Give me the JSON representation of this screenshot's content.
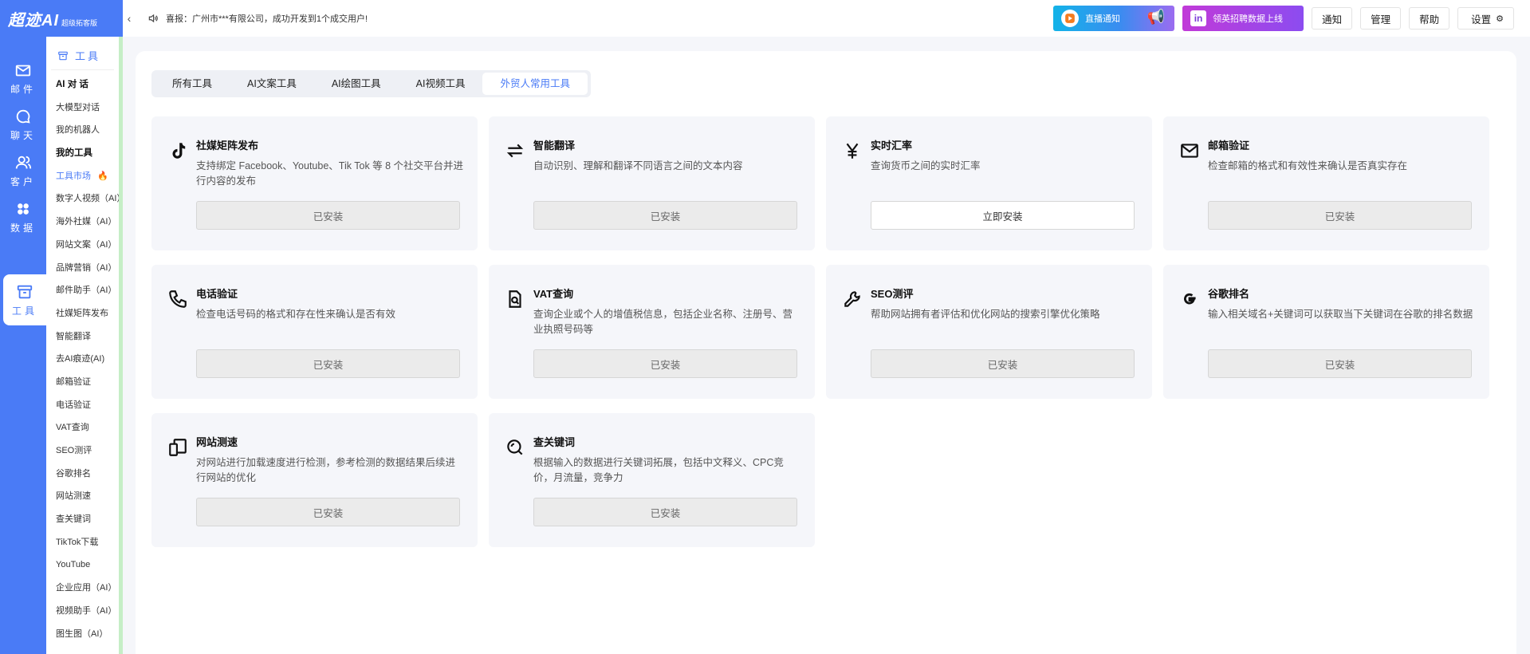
{
  "logo": {
    "main": "超迹AI",
    "sub": "超级拓客版"
  },
  "rail": [
    {
      "label": "邮件",
      "icon": "mail-icon"
    },
    {
      "label": "聊天",
      "icon": "chat-icon"
    },
    {
      "label": "客户",
      "icon": "customers-icon"
    },
    {
      "label": "数据",
      "icon": "data-icon"
    },
    {
      "label": "工具",
      "icon": "toolbox-icon",
      "active": true
    }
  ],
  "submenu": {
    "title": "工具",
    "items": [
      {
        "label": "AI 对 话",
        "group": true
      },
      {
        "label": "大模型对话"
      },
      {
        "label": "我的机器人"
      },
      {
        "label": "我的工具",
        "group": true
      },
      {
        "label": "工具市场",
        "active": true,
        "hot": true
      },
      {
        "label": "数字人视频（AI）"
      },
      {
        "label": "海外社媒（AI）"
      },
      {
        "label": "网站文案（AI）"
      },
      {
        "label": "品牌营销（AI）"
      },
      {
        "label": "邮件助手（AI）"
      },
      {
        "label": "社媒矩阵发布"
      },
      {
        "label": "智能翻译"
      },
      {
        "label": "去AI痕迹(AI)"
      },
      {
        "label": "邮箱验证"
      },
      {
        "label": "电话验证"
      },
      {
        "label": "VAT查询"
      },
      {
        "label": "SEO测评"
      },
      {
        "label": "谷歌排名"
      },
      {
        "label": "网站测速"
      },
      {
        "label": "查关键词"
      },
      {
        "label": "TikTok下载"
      },
      {
        "label": "YouTube"
      },
      {
        "label": "企业应用（AI）"
      },
      {
        "label": "视频助手（AI）"
      },
      {
        "label": "图生图（AI）"
      }
    ]
  },
  "topbar": {
    "collapse": "‹",
    "notice": "喜报：广州市***有限公司，成功开发到1个成交用户!",
    "banner_live": "直播通知",
    "banner_hire": "领英招聘数据上线",
    "notify": "通知",
    "manage": "管理",
    "help": "帮助",
    "settings": "设置"
  },
  "tabs": [
    {
      "label": "所有工具"
    },
    {
      "label": "AI文案工具"
    },
    {
      "label": "AI绘图工具"
    },
    {
      "label": "AI视频工具"
    },
    {
      "label": "外贸人常用工具",
      "active": true
    }
  ],
  "cards": [
    {
      "icon": "tiktok-icon",
      "title": "社媒矩阵发布",
      "desc": "支持绑定 Facebook、Youtube、Tik Tok 等 8 个社交平台并进行内容的发布",
      "button": "已安装",
      "installed": true
    },
    {
      "icon": "translate-icon",
      "title": "智能翻译",
      "desc": "自动识别、理解和翻译不同语言之间的文本内容",
      "button": "已安装",
      "installed": true
    },
    {
      "icon": "yen-icon",
      "title": "实时汇率",
      "desc": "查询货币之间的实时汇率",
      "button": "立即安装",
      "installed": false
    },
    {
      "icon": "mail-icon",
      "title": "邮箱验证",
      "desc": "检查邮箱的格式和有效性来确认是否真实存在",
      "button": "已安装",
      "installed": true
    },
    {
      "icon": "phone-icon",
      "title": "电话验证",
      "desc": "检查电话号码的格式和存在性来确认是否有效",
      "button": "已安装",
      "installed": true
    },
    {
      "icon": "document-search-icon",
      "title": "VAT查询",
      "desc": "查询企业或个人的增值税信息，包括企业名称、注册号、营业执照号码等",
      "button": "已安装",
      "installed": true
    },
    {
      "icon": "wrench-icon",
      "title": "SEO测评",
      "desc": "帮助网站拥有者评估和优化网站的搜索引擎优化策略",
      "button": "已安装",
      "installed": true
    },
    {
      "icon": "google-icon",
      "title": "谷歌排名",
      "desc": "输入相关域名+关键词可以获取当下关键词在谷歌的排名数据",
      "button": "已安装",
      "installed": true
    },
    {
      "icon": "devices-icon",
      "title": "网站测速",
      "desc": "对网站进行加载速度进行检测，参考检测的数据结果后续进行网站的优化",
      "button": "已安装",
      "installed": true
    },
    {
      "icon": "search-icon",
      "title": "查关键词",
      "desc": "根据输入的数据进行关键词拓展，包括中文释义、CPC竞价，月流量，竞争力",
      "button": "已安装",
      "installed": true
    }
  ]
}
